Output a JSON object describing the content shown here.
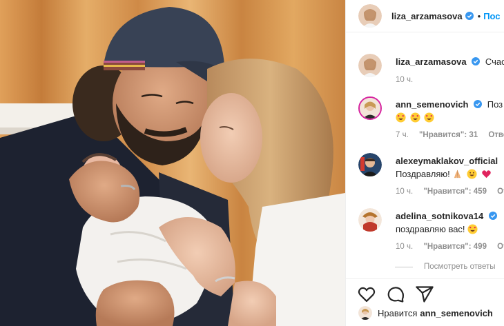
{
  "post": {
    "author": "liza_arzamasova",
    "separator": "•",
    "follow_label": "Пос"
  },
  "comments": [
    {
      "user": "liza_arzamasova",
      "text": "Счас",
      "time": "10 ч."
    },
    {
      "user": "ann_semenovich",
      "text": "Поз",
      "emojis": [
        "heart-eyes",
        "heart-eyes",
        "heart-eyes"
      ],
      "time": "7 ч.",
      "likes": "\"Нравится\": 31",
      "reply": "Отве"
    },
    {
      "user": "alexeymaklakov_official",
      "text": "Поздравляю!",
      "emojis": [
        "praying-hands",
        "smile",
        "red-heart"
      ],
      "time": "10 ч.",
      "likes": "\"Нравится\": 459",
      "reply": "От"
    },
    {
      "user": "adelina_sotnikova14",
      "text": "поздравляю вас!",
      "emojis": [
        "heart-eyes"
      ],
      "time": "10 ч.",
      "likes": "\"Нравится\": 499",
      "reply": "От"
    }
  ],
  "view_replies": "Посмотреть ответы",
  "liked_by": {
    "prefix": "Нравится",
    "user": "ann_semenovich"
  },
  "colors": {
    "follow": "#0095f6",
    "verified": "#3897f0",
    "meta": "#8e8e8e",
    "photo_background": "#d79a55"
  },
  "icons": [
    "verified-badge-icon",
    "like-heart-icon",
    "comment-icon",
    "share-icon"
  ]
}
